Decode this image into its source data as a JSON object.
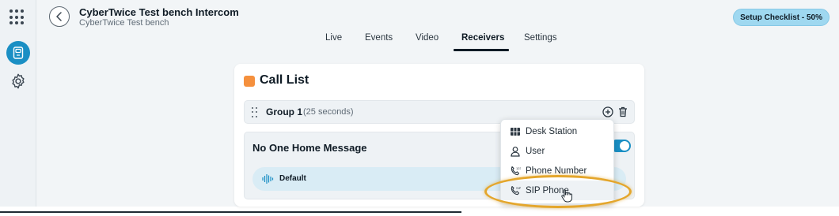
{
  "header": {
    "title": "CyberTwice Test bench Intercom",
    "subtitle": "CyberTwice Test bench",
    "checklist_label": "Setup Checklist - 50%"
  },
  "sidebar": {
    "icons": [
      "grid-icon",
      "intercom-icon",
      "gear-icon"
    ],
    "active": "intercom-icon"
  },
  "tabs": [
    {
      "label": "Live"
    },
    {
      "label": "Events"
    },
    {
      "label": "Video"
    },
    {
      "label": "Receivers",
      "active": true
    },
    {
      "label": "Settings"
    }
  ],
  "call_list": {
    "title": "Call List",
    "group": {
      "name": "Group 1",
      "duration": "(25 seconds)"
    },
    "no_one_home": {
      "label": "No One Home Message",
      "enabled": true,
      "default_label": "Default"
    }
  },
  "dropdown": {
    "items": [
      {
        "label": "Desk Station",
        "icon": "desk-station-icon"
      },
      {
        "label": "User",
        "icon": "user-icon"
      },
      {
        "label": "Phone Number",
        "icon": "phone-number-icon"
      },
      {
        "label": "SIP Phone",
        "icon": "sip-phone-icon",
        "hovered": true
      }
    ]
  },
  "colors": {
    "accent_blue": "#1a8fc4",
    "accent_orange": "#f5903d",
    "highlight": "#e4a62c",
    "checklist_bg": "#9fd8f0"
  }
}
